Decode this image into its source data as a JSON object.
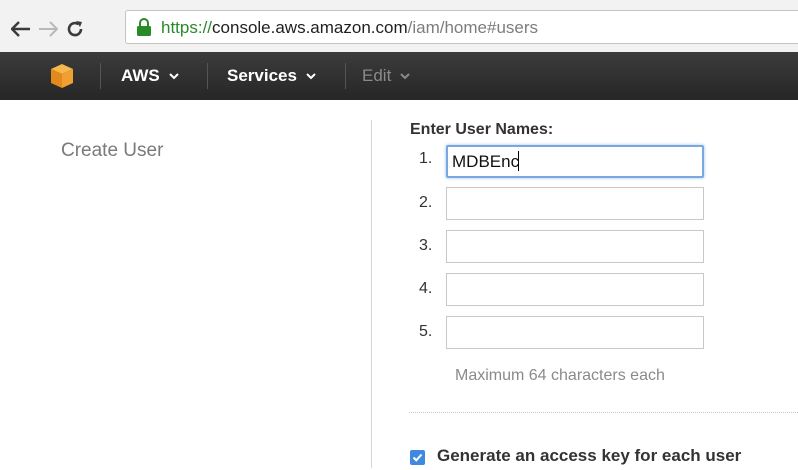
{
  "browser": {
    "url_scheme": "https://",
    "url_host": "console.aws.amazon.com",
    "url_path": "/iam/home#users"
  },
  "aws_nav": {
    "items": [
      {
        "label": "AWS",
        "enabled": true
      },
      {
        "label": "Services",
        "enabled": true
      },
      {
        "label": "Edit",
        "enabled": false
      }
    ]
  },
  "sidebar": {
    "title": "Create User"
  },
  "form": {
    "heading": "Enter User Names:",
    "rows": [
      {
        "number": "1.",
        "value": "MDBEnc",
        "focused": true
      },
      {
        "number": "2.",
        "value": ""
      },
      {
        "number": "3.",
        "value": ""
      },
      {
        "number": "4.",
        "value": ""
      },
      {
        "number": "5.",
        "value": ""
      }
    ],
    "hint": "Maximum 64 characters each",
    "access_key_checkbox": {
      "checked": true,
      "label": "Generate an access key for each user"
    }
  },
  "colors": {
    "nav_background": "#2f2f2f",
    "focus_border": "#79a8e0",
    "checkbox": "#3f8ae0",
    "url_scheme": "#2a8a2a",
    "aws_orange": "#f0a030"
  },
  "icons": [
    "back-arrow-icon",
    "forward-arrow-icon",
    "reload-icon",
    "lock-icon",
    "aws-cube-icon",
    "chevron-down-icon",
    "checkmark-icon"
  ]
}
